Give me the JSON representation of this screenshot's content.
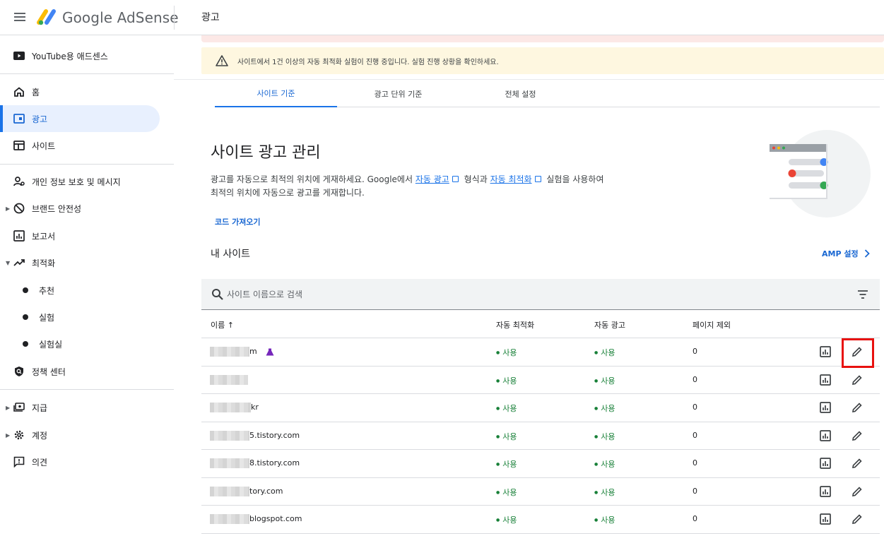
{
  "app": {
    "logo_text": "Google AdSense",
    "page_title": "광고"
  },
  "sidebar": {
    "youtube_label": "YouTube용 애드센스",
    "items": [
      {
        "label": "홈",
        "icon": "home-icon"
      },
      {
        "label": "광고",
        "icon": "ads-icon",
        "active": true
      },
      {
        "label": "사이트",
        "icon": "sites-icon"
      },
      {
        "label": "개인 정보 보호 및 메시지",
        "icon": "privacy-icon"
      },
      {
        "label": "브랜드 안전성",
        "icon": "block-icon"
      },
      {
        "label": "보고서",
        "icon": "reports-icon"
      },
      {
        "label": "최적화",
        "icon": "trending-icon"
      },
      {
        "label": "추천"
      },
      {
        "label": "실험"
      },
      {
        "label": "실험실"
      },
      {
        "label": "정책 센터",
        "icon": "policy-icon"
      },
      {
        "label": "지급",
        "icon": "payments-icon"
      },
      {
        "label": "계정",
        "icon": "gear-icon"
      },
      {
        "label": "의견",
        "icon": "feedback-icon"
      }
    ]
  },
  "alert": {
    "text": "사이트에서 1건 이상의 자동 최적화 실험이 진행 중입니다. 실험 진행 상황을 확인하세요."
  },
  "tabs": [
    {
      "label": "사이트 기준",
      "active": true
    },
    {
      "label": "광고 단위 기준"
    },
    {
      "label": "전체 설정"
    }
  ],
  "main": {
    "title": "사이트 광고 관리",
    "desc_1": "광고를 자동으로 최적의 위치에 게재하세요. Google에서 ",
    "link_auto_ads": "자동 광고",
    "desc_2": " 형식과 ",
    "link_auto_opt": "자동 최적화",
    "desc_3": " 실험을 사용하여",
    "desc_4": "최적의 위치에 자동으로 광고를 게재합니다.",
    "get_code": "코드 가져오기",
    "my_sites": "내 사이트",
    "amp_settings": "AMP 설정"
  },
  "search": {
    "placeholder": "사이트 이름으로 검색"
  },
  "table": {
    "headers": {
      "name": "이름",
      "auto_opt": "자동 최적화",
      "auto_ads": "자동 광고",
      "page_excl": "페이지 제외"
    },
    "rows": [
      {
        "name_suffix": "m",
        "auto_opt": "사용",
        "auto_ads": "사용",
        "excl": "0"
      },
      {
        "name_suffix": "",
        "auto_opt": "사용",
        "auto_ads": "사용",
        "excl": "0"
      },
      {
        "name_suffix": "kr",
        "auto_opt": "사용",
        "auto_ads": "사용",
        "excl": "0"
      },
      {
        "name_suffix": "5.tistory.com",
        "auto_opt": "사용",
        "auto_ads": "사용",
        "excl": "0"
      },
      {
        "name_suffix": "8.tistory.com",
        "auto_opt": "사용",
        "auto_ads": "사용",
        "excl": "0"
      },
      {
        "name_suffix": "tory.com",
        "auto_opt": "사용",
        "auto_ads": "사용",
        "excl": "0"
      },
      {
        "name_suffix": "blogspot.com",
        "auto_opt": "사용",
        "auto_ads": "사용",
        "excl": "0"
      }
    ]
  },
  "colors": {
    "accent": "#1a73e8",
    "status_green": "#188038",
    "highlight_red": "#e8110f",
    "alert_bg": "#fef7e0"
  }
}
